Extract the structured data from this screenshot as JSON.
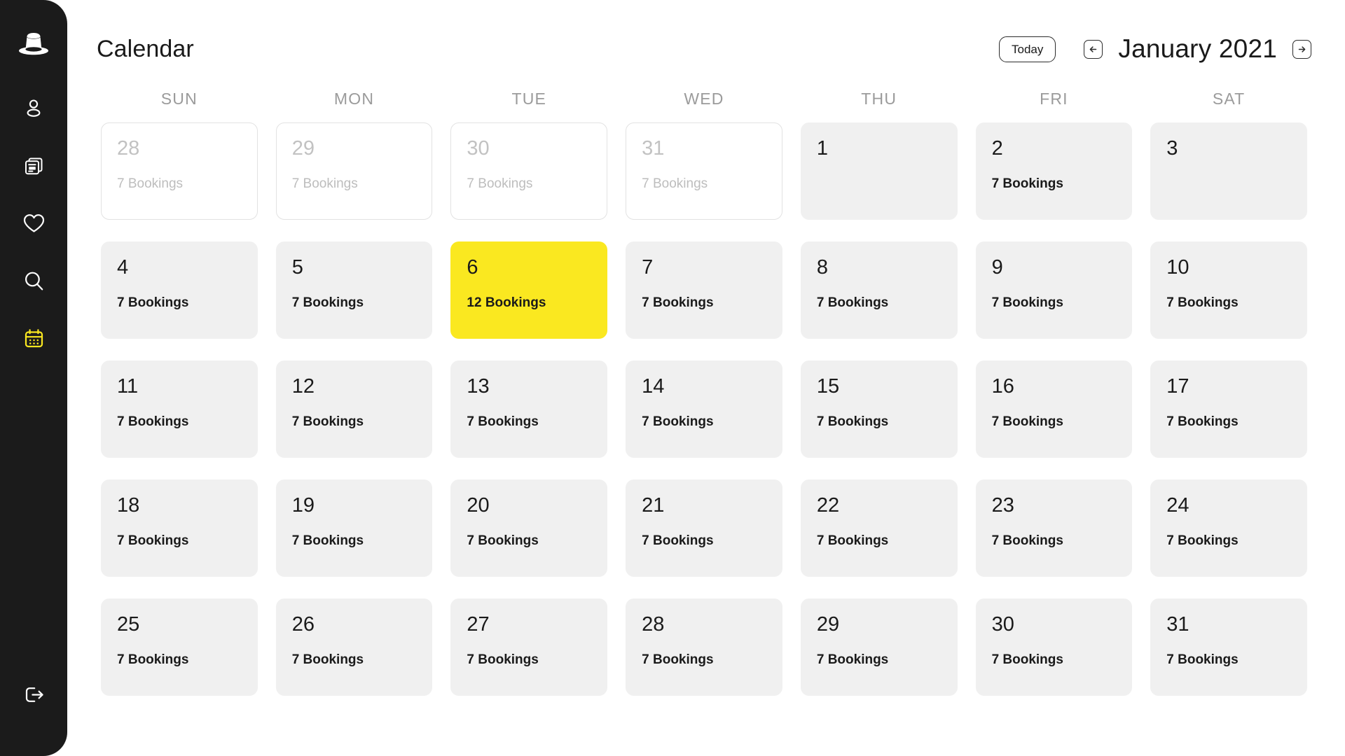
{
  "colors": {
    "sidebar_bg": "#1b1b1b",
    "accent_yellow": "#fae820",
    "cell_bg": "#f0f0f0",
    "muted_text": "#9b9b9b",
    "page_bg": "#ffffff"
  },
  "sidebar": {
    "logo": {
      "icon": "top-hat-logo-icon",
      "label": "Top Hat"
    },
    "items": [
      {
        "icon": "user-icon",
        "label": "Profile",
        "active": false
      },
      {
        "icon": "cards-stack-icon",
        "label": "Listings",
        "active": false
      },
      {
        "icon": "heart-icon",
        "label": "Favorites",
        "active": false
      },
      {
        "icon": "search-icon",
        "label": "Search",
        "active": false
      },
      {
        "icon": "calendar-icon",
        "label": "Calendar",
        "active": true
      }
    ],
    "logout": {
      "icon": "logout-icon",
      "label": "Log out"
    }
  },
  "header": {
    "title": "Calendar",
    "today_label": "Today",
    "prev_icon": "arrow-left-icon",
    "next_icon": "arrow-right-icon",
    "month_label": "January 2021"
  },
  "weekdays": [
    "SUN",
    "MON",
    "TUE",
    "WED",
    "THU",
    "FRI",
    "SAT"
  ],
  "days": [
    {
      "number": "28",
      "bookings": "7 Bookings",
      "outside": true,
      "highlight": false
    },
    {
      "number": "29",
      "bookings": "7 Bookings",
      "outside": true,
      "highlight": false
    },
    {
      "number": "30",
      "bookings": "7 Bookings",
      "outside": true,
      "highlight": false
    },
    {
      "number": "31",
      "bookings": "7 Bookings",
      "outside": true,
      "highlight": false
    },
    {
      "number": "1",
      "bookings": "",
      "outside": false,
      "highlight": false
    },
    {
      "number": "2",
      "bookings": "7 Bookings",
      "outside": false,
      "highlight": false
    },
    {
      "number": "3",
      "bookings": "",
      "outside": false,
      "highlight": false
    },
    {
      "number": "4",
      "bookings": "7 Bookings",
      "outside": false,
      "highlight": false
    },
    {
      "number": "5",
      "bookings": "7 Bookings",
      "outside": false,
      "highlight": false
    },
    {
      "number": "6",
      "bookings": "12 Bookings",
      "outside": false,
      "highlight": true
    },
    {
      "number": "7",
      "bookings": "7 Bookings",
      "outside": false,
      "highlight": false
    },
    {
      "number": "8",
      "bookings": "7 Bookings",
      "outside": false,
      "highlight": false
    },
    {
      "number": "9",
      "bookings": "7 Bookings",
      "outside": false,
      "highlight": false
    },
    {
      "number": "10",
      "bookings": "7 Bookings",
      "outside": false,
      "highlight": false
    },
    {
      "number": "11",
      "bookings": "7 Bookings",
      "outside": false,
      "highlight": false
    },
    {
      "number": "12",
      "bookings": "7 Bookings",
      "outside": false,
      "highlight": false
    },
    {
      "number": "13",
      "bookings": "7 Bookings",
      "outside": false,
      "highlight": false
    },
    {
      "number": "14",
      "bookings": "7 Bookings",
      "outside": false,
      "highlight": false
    },
    {
      "number": "15",
      "bookings": "7 Bookings",
      "outside": false,
      "highlight": false
    },
    {
      "number": "16",
      "bookings": "7 Bookings",
      "outside": false,
      "highlight": false
    },
    {
      "number": "17",
      "bookings": "7 Bookings",
      "outside": false,
      "highlight": false
    },
    {
      "number": "18",
      "bookings": "7 Bookings",
      "outside": false,
      "highlight": false
    },
    {
      "number": "19",
      "bookings": "7 Bookings",
      "outside": false,
      "highlight": false
    },
    {
      "number": "20",
      "bookings": "7 Bookings",
      "outside": false,
      "highlight": false
    },
    {
      "number": "21",
      "bookings": "7 Bookings",
      "outside": false,
      "highlight": false
    },
    {
      "number": "22",
      "bookings": "7 Bookings",
      "outside": false,
      "highlight": false
    },
    {
      "number": "23",
      "bookings": "7 Bookings",
      "outside": false,
      "highlight": false
    },
    {
      "number": "24",
      "bookings": "7 Bookings",
      "outside": false,
      "highlight": false
    },
    {
      "number": "25",
      "bookings": "7 Bookings",
      "outside": false,
      "highlight": false
    },
    {
      "number": "26",
      "bookings": "7 Bookings",
      "outside": false,
      "highlight": false
    },
    {
      "number": "27",
      "bookings": "7 Bookings",
      "outside": false,
      "highlight": false
    },
    {
      "number": "28",
      "bookings": "7 Bookings",
      "outside": false,
      "highlight": false
    },
    {
      "number": "29",
      "bookings": "7 Bookings",
      "outside": false,
      "highlight": false
    },
    {
      "number": "30",
      "bookings": "7 Bookings",
      "outside": false,
      "highlight": false
    },
    {
      "number": "31",
      "bookings": "7 Bookings",
      "outside": false,
      "highlight": false
    }
  ]
}
